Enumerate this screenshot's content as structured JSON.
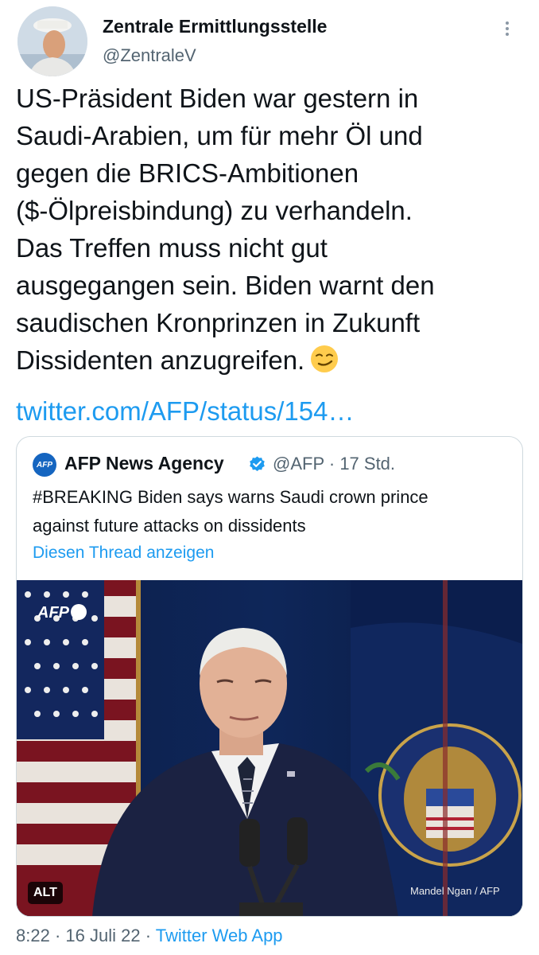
{
  "author": {
    "name": "Zentrale Ermittlungsstelle",
    "handle": "@ZentraleV"
  },
  "tweet": {
    "text_lines": [
      "US-Präsident Biden war gestern in",
      "Saudi-Arabien, um für mehr Öl und",
      "gegen die BRICS-Ambitionen",
      "($-Ölpreisbindung) zu verhandeln.",
      "Das Treffen muss nicht gut",
      "ausgegangen sein. Biden warnt den",
      "saudischen Kronprinzen in Zukunft",
      "Dissidenten anzugreifen."
    ],
    "emoji": "smirking-face-emoji",
    "link": "twitter.com/AFP/status/154…"
  },
  "quoted": {
    "avatar_text": "AFP",
    "name": "AFP News Agency",
    "verified": true,
    "handle": "@AFP",
    "separator": "·",
    "time": "17 Std.",
    "text_lines": [
      "#BREAKING Biden says warns Saudi crown prince",
      "against future attacks on dissidents"
    ],
    "thread_link": "Diesen Thread anzeigen",
    "photo": {
      "watermark": "AFP",
      "alt_badge": "ALT",
      "credit": "Mandel Ngan / AFP"
    }
  },
  "footer": {
    "time": "8:22",
    "sep1": "·",
    "date": "16 Juli 22",
    "sep2": "·",
    "source": "Twitter Web App"
  },
  "colors": {
    "text": "#0f1419",
    "secondary": "#536471",
    "link": "#1d9bf0",
    "border": "#cfd9de"
  }
}
